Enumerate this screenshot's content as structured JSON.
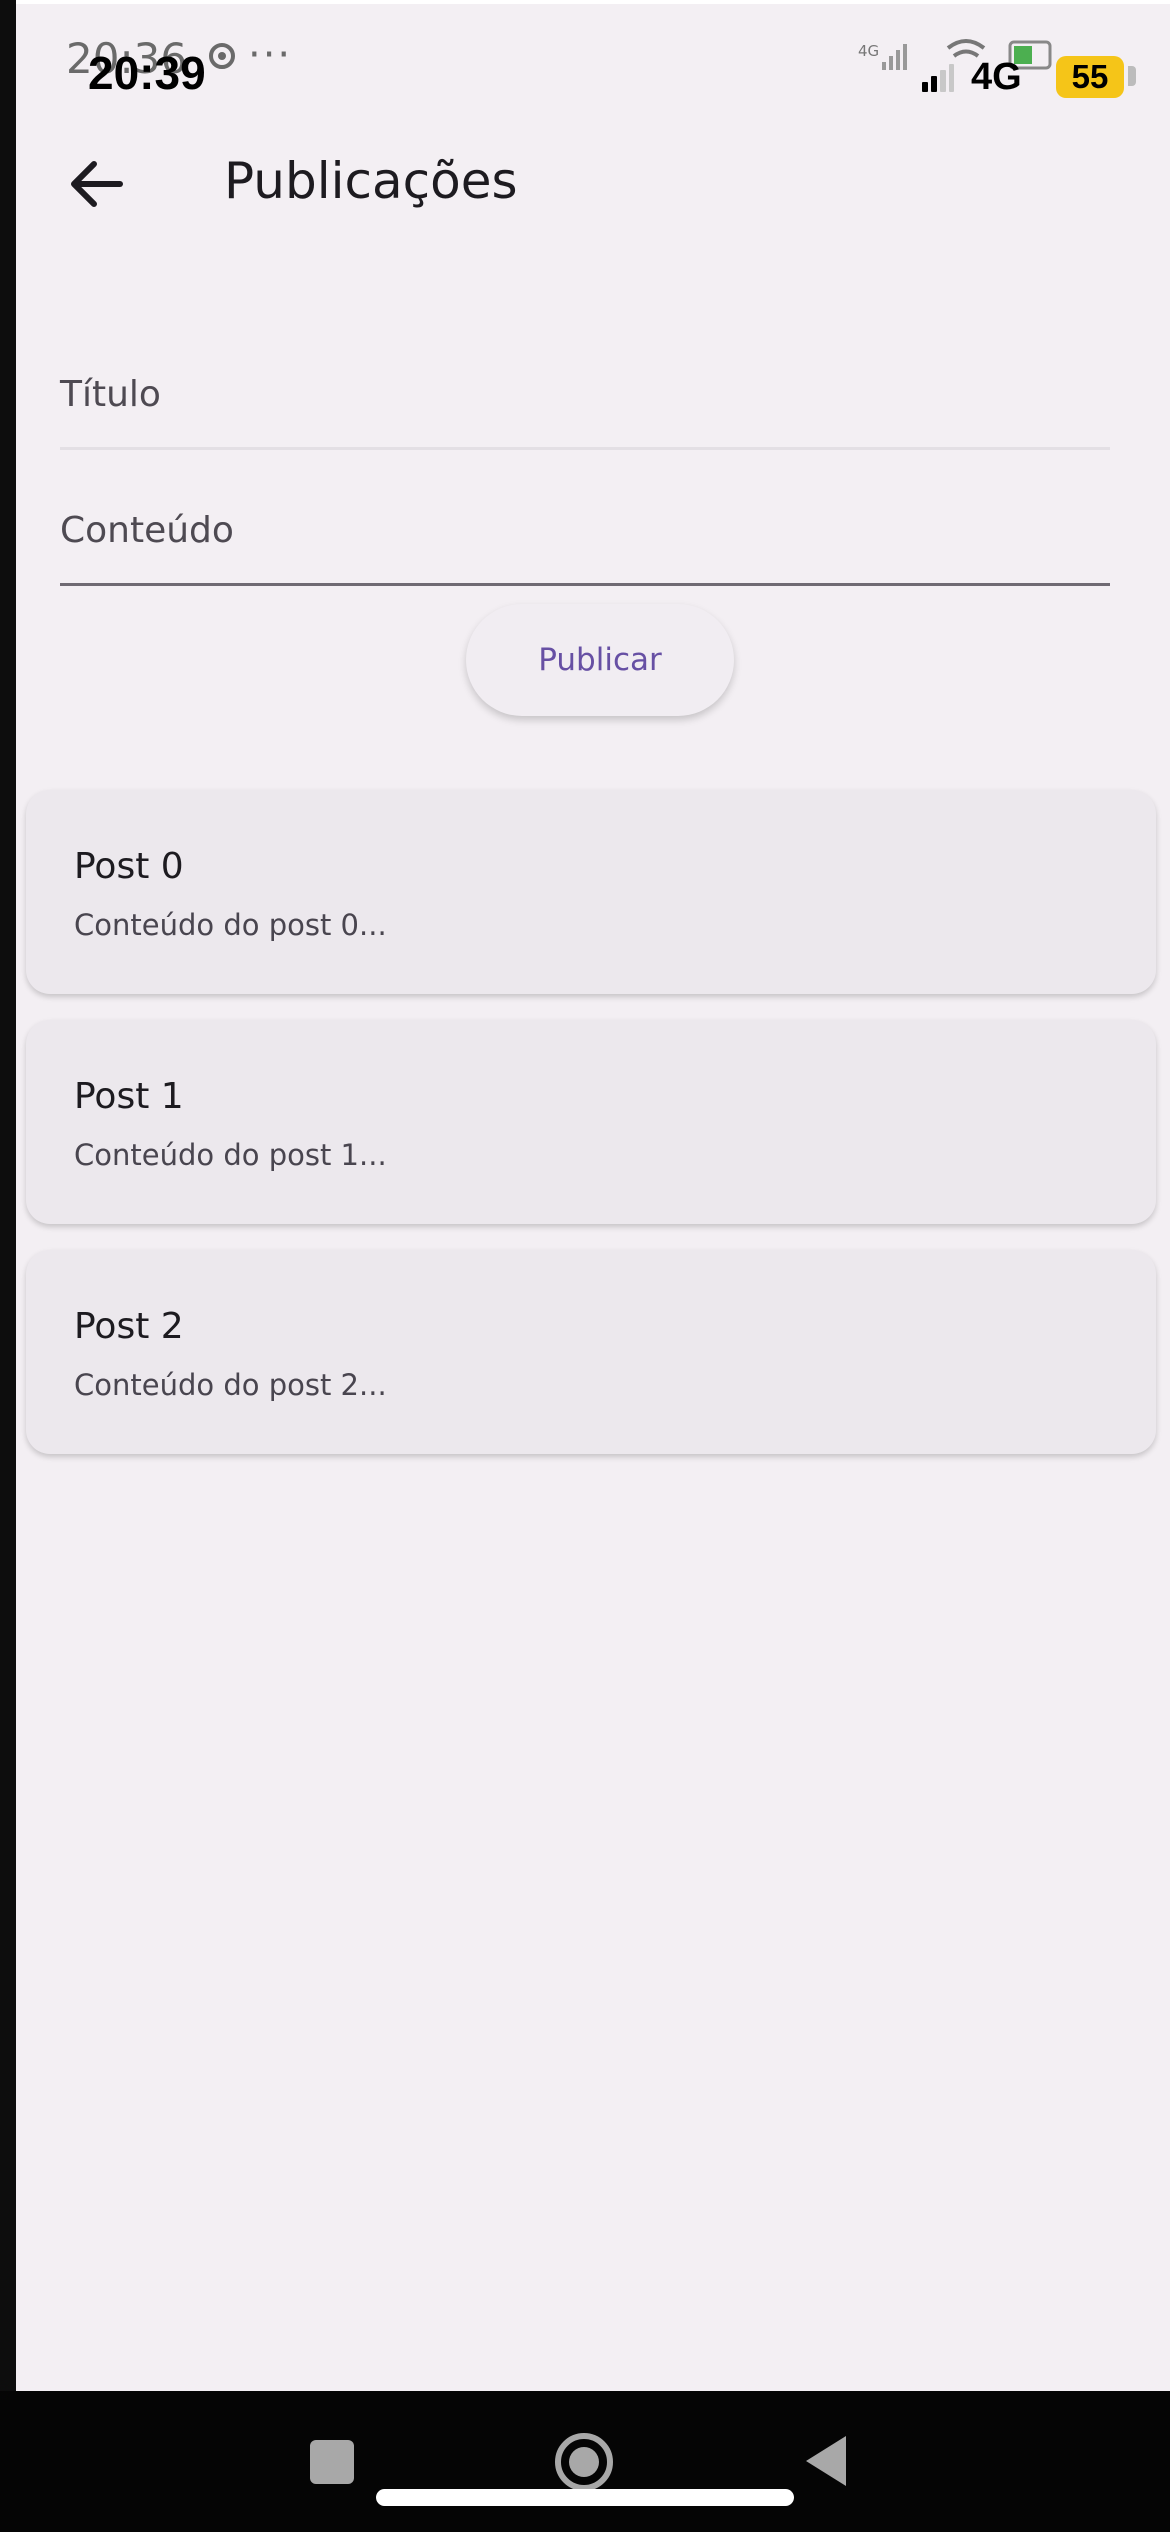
{
  "status_bar": {
    "android_time": "20:36",
    "android_dots": "···",
    "ios_time": "20:39",
    "network": "4G",
    "battery": "55",
    "icons": [
      "signal-icon",
      "wifi-icon",
      "battery-icon",
      "settings-icon"
    ]
  },
  "app_bar": {
    "title": "Publicações",
    "back_icon": "arrow-back-icon"
  },
  "form": {
    "title_label": "Título",
    "title_value": "",
    "content_label": "Conteúdo",
    "content_value": "",
    "publish_label": "Publicar"
  },
  "posts": [
    {
      "title": "Post 0",
      "content": "Conteúdo do post 0..."
    },
    {
      "title": "Post 1",
      "content": "Conteúdo do post 1..."
    },
    {
      "title": "Post 2",
      "content": "Conteúdo do post 2..."
    }
  ],
  "nav_bar": {
    "items": [
      "recents-icon",
      "home-icon",
      "back-icon"
    ]
  },
  "colors": {
    "background": "#f3eff3",
    "card": "#ece8ed",
    "accent": "#6750a4",
    "battery": "#f5c518"
  }
}
